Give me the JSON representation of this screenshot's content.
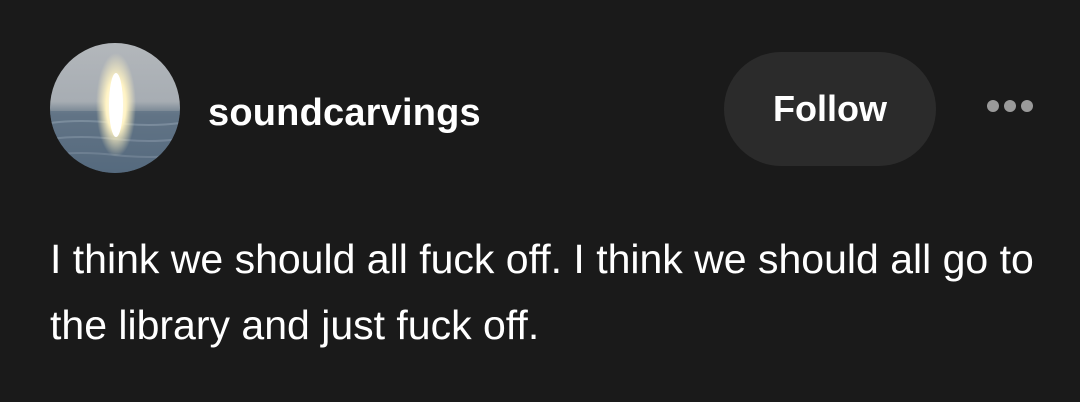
{
  "post": {
    "username": "soundcarvings",
    "follow_label": "Follow",
    "body_text": "I think we should all fuck off. I think we should all go to the library and just fuck off."
  },
  "icons": {
    "more": "more-horizontal-icon",
    "avatar": "avatar-image"
  },
  "colors": {
    "background": "#1a1a1a",
    "button_background": "#2b2b2b",
    "text": "#ffffff",
    "icon": "#9a9a9a"
  }
}
